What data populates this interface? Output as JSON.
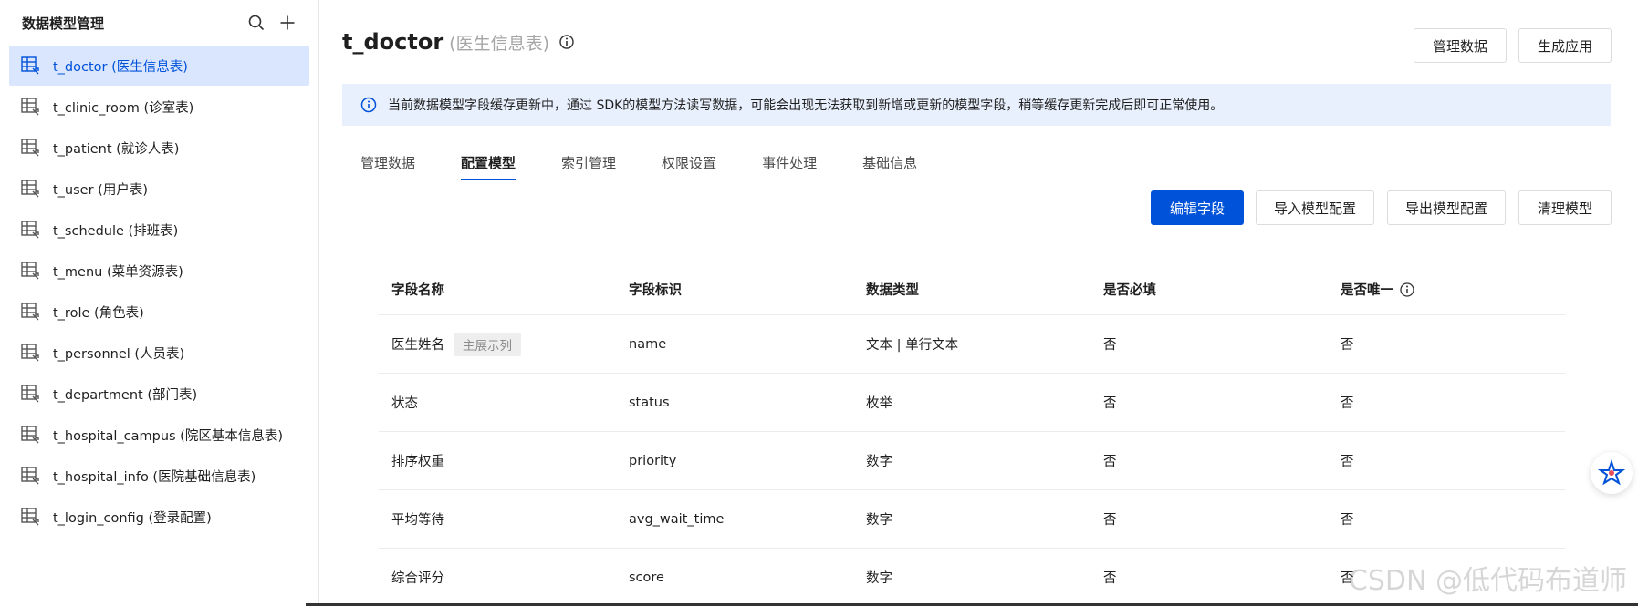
{
  "sidebar": {
    "title": "数据模型管理",
    "search_icon": "search-icon",
    "add_icon": "plus-icon",
    "items": [
      {
        "label": "t_doctor (医生信息表)",
        "active": true
      },
      {
        "label": "t_clinic_room (诊室表)"
      },
      {
        "label": "t_patient (就诊人表)"
      },
      {
        "label": "t_user (用户表)"
      },
      {
        "label": "t_schedule (排班表)"
      },
      {
        "label": "t_menu (菜单资源表)"
      },
      {
        "label": "t_role (角色表)"
      },
      {
        "label": "t_personnel (人员表)"
      },
      {
        "label": "t_department (部门表)"
      },
      {
        "label": "t_hospital_campus (院区基本信息表)"
      },
      {
        "label": "t_hospital_info (医院基础信息表)"
      },
      {
        "label": "t_login_config (登录配置)"
      }
    ]
  },
  "header": {
    "title": "t_doctor",
    "subtitle": "(医生信息表)",
    "manage_data_label": "管理数据",
    "generate_app_label": "生成应用"
  },
  "alert": {
    "text": "当前数据模型字段缓存更新中，通过 SDK的模型方法读写数据，可能会出现无法获取到新增或更新的模型字段，稍等缓存更新完成后即可正常使用。"
  },
  "tabs": [
    {
      "label": "管理数据"
    },
    {
      "label": "配置模型",
      "active": true
    },
    {
      "label": "索引管理"
    },
    {
      "label": "权限设置"
    },
    {
      "label": "事件处理"
    },
    {
      "label": "基础信息"
    }
  ],
  "actions": {
    "edit_fields": "编辑字段",
    "import_config": "导入模型配置",
    "export_config": "导出模型配置",
    "clear_model": "清理模型"
  },
  "table": {
    "columns": [
      "字段名称",
      "字段标识",
      "数据类型",
      "是否必填",
      "是否唯一"
    ],
    "rows": [
      {
        "name": "医生姓名",
        "tag": "主展示列",
        "key": "name",
        "type": "文本 | 单行文本",
        "required": "否",
        "unique": "否"
      },
      {
        "name": "状态",
        "key": "status",
        "type": "枚举",
        "required": "否",
        "unique": "否"
      },
      {
        "name": "排序权重",
        "key": "priority",
        "type": "数字",
        "required": "否",
        "unique": "否"
      },
      {
        "name": "平均等待",
        "key": "avg_wait_time",
        "type": "数字",
        "required": "否",
        "unique": "否"
      },
      {
        "name": "综合评分",
        "key": "score",
        "type": "数字",
        "required": "否",
        "unique": "否"
      }
    ]
  },
  "watermark": "CSDN @低代码布道师",
  "colors": {
    "accent": "#0052d9",
    "active_bg": "#d9e6fd",
    "alert_bg": "#e8f0fd"
  }
}
